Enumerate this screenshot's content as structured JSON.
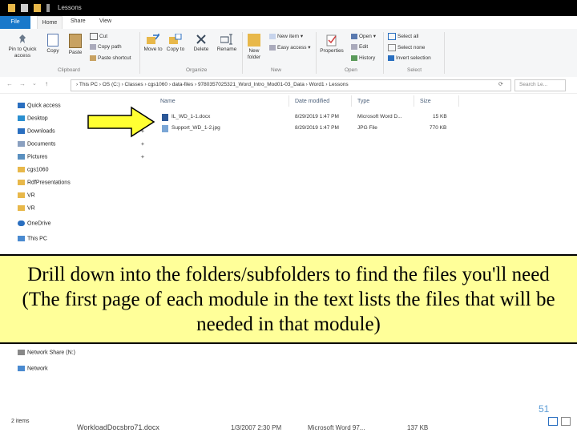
{
  "window": {
    "title": "Lessons"
  },
  "tabs": {
    "file": "File",
    "home": "Home",
    "share": "Share",
    "view": "View"
  },
  "ribbon": {
    "pin_quick_access": "Pin to Quick access",
    "copy": "Copy",
    "paste": "Paste",
    "cut": "Cut",
    "copy_path": "Copy path",
    "paste_shortcut": "Paste shortcut",
    "move_to": "Move to",
    "copy_to": "Copy to",
    "delete": "Delete",
    "rename": "Rename",
    "new_folder": "New folder",
    "new_item": "New item",
    "easy_access": "Easy access",
    "properties": "Properties",
    "open": "Open",
    "edit": "Edit",
    "history": "History",
    "select_all": "Select all",
    "select_none": "Select none",
    "invert_selection": "Invert selection",
    "groups": {
      "clipboard": "Clipboard",
      "organize": "Organize",
      "new": "New",
      "open": "Open",
      "select": "Select"
    }
  },
  "address": {
    "crumbs": "›  This PC  ›  OS (C:)  ›  Classes  ›  cgs1060  ›  data-files  ›  9780357025321_Word_Intro_Mod01-03_Data  ›  Word1  ›  Lessons",
    "search_placeholder": "Search Le..."
  },
  "nav": {
    "quick_access": "Quick access",
    "desktop": "Desktop",
    "downloads": "Downloads",
    "documents": "Documents",
    "pictures": "Pictures",
    "cgs1060": "cgs1060",
    "rdf_presentations": "RdfPresentations",
    "vr1": "VR",
    "vr2": "VR",
    "onedrive": "OneDrive",
    "this_pc": "This PC",
    "network_share": "Network Share (N:)",
    "network": "Network"
  },
  "columns": {
    "name": "Name",
    "date_modified": "Date modified",
    "type": "Type",
    "size": "Size"
  },
  "files": [
    {
      "name": "IL_WD_1-1.docx",
      "date": "8/29/2019 1:47 PM",
      "type": "Microsoft Word D...",
      "size": "15 KB"
    },
    {
      "name": "Support_WD_1-2.jpg",
      "date": "8/29/2019 1:47 PM",
      "type": "JPG File",
      "size": "770 KB"
    }
  ],
  "caption": "Drill down into the folders/subfolders to find the files you'll need (The first page of each module in the text lists the files that will be needed in that module)",
  "status": {
    "items": "2 items",
    "bg_file_name": "WorkloadDocsbro71.docx",
    "bg_file_date": "1/3/2007 2:30 PM",
    "bg_file_type": "Microsoft Word 97...",
    "bg_file_size": "137 KB"
  },
  "slide_number": "51",
  "colors": {
    "accent": "#1979ca",
    "caption_bg": "#ffff99",
    "arrow_fill": "#ffff33",
    "slide_number": "#5a9bd5"
  }
}
